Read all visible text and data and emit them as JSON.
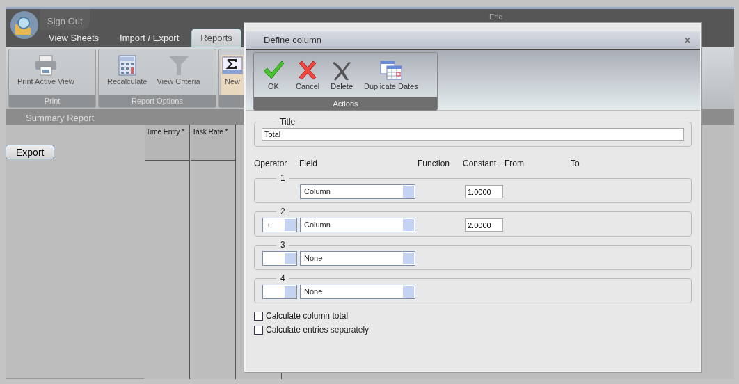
{
  "app": {
    "sign_out": "Sign Out",
    "user": "Eric",
    "tabs": [
      {
        "label": "View Sheets",
        "selected": false
      },
      {
        "label": "Import / Export",
        "selected": false
      },
      {
        "label": "Reports",
        "selected": true
      }
    ],
    "ribbon_groups": [
      {
        "label": "Print",
        "buttons": [
          {
            "label": "Print Active View",
            "kind": "print"
          }
        ]
      },
      {
        "label": "Report Options",
        "buttons": [
          {
            "label": "Recalculate",
            "kind": "calculator"
          },
          {
            "label": "View Criteria",
            "kind": "funnel"
          }
        ]
      },
      {
        "buttons": [
          {
            "label": "New",
            "kind": "sigma"
          }
        ]
      }
    ],
    "summary_title": "Summary Report",
    "export_button": "Export",
    "grid_columns": [
      "Time Entry *",
      "Task Rate *"
    ]
  },
  "dialog": {
    "title": "Define column",
    "close": "x",
    "actions": {
      "label": "Actions",
      "buttons": [
        {
          "label": "OK",
          "kind": "ok"
        },
        {
          "label": "Cancel",
          "kind": "cancel"
        },
        {
          "label": "Delete",
          "kind": "delete"
        },
        {
          "label": "Duplicate Dates",
          "kind": "calendar"
        }
      ]
    },
    "title_section": {
      "legend": "Title",
      "value": "Total"
    },
    "headers": [
      "Operator",
      "Field",
      "Function",
      "Constant",
      "From",
      "To"
    ],
    "operands": [
      {
        "legend": "1",
        "has_operator": false,
        "field": "Column",
        "constant": "1.0000"
      },
      {
        "legend": "2",
        "has_operator": true,
        "operator": "+",
        "field": "Column",
        "constant": "2.0000"
      },
      {
        "legend": "3",
        "has_operator": true,
        "field": "None"
      },
      {
        "legend": "4",
        "has_operator": true,
        "field": "None"
      }
    ],
    "checkboxes": [
      {
        "label": "Calculate column total",
        "checked": false
      },
      {
        "label": "Calculate entries separately",
        "checked": false
      }
    ]
  }
}
